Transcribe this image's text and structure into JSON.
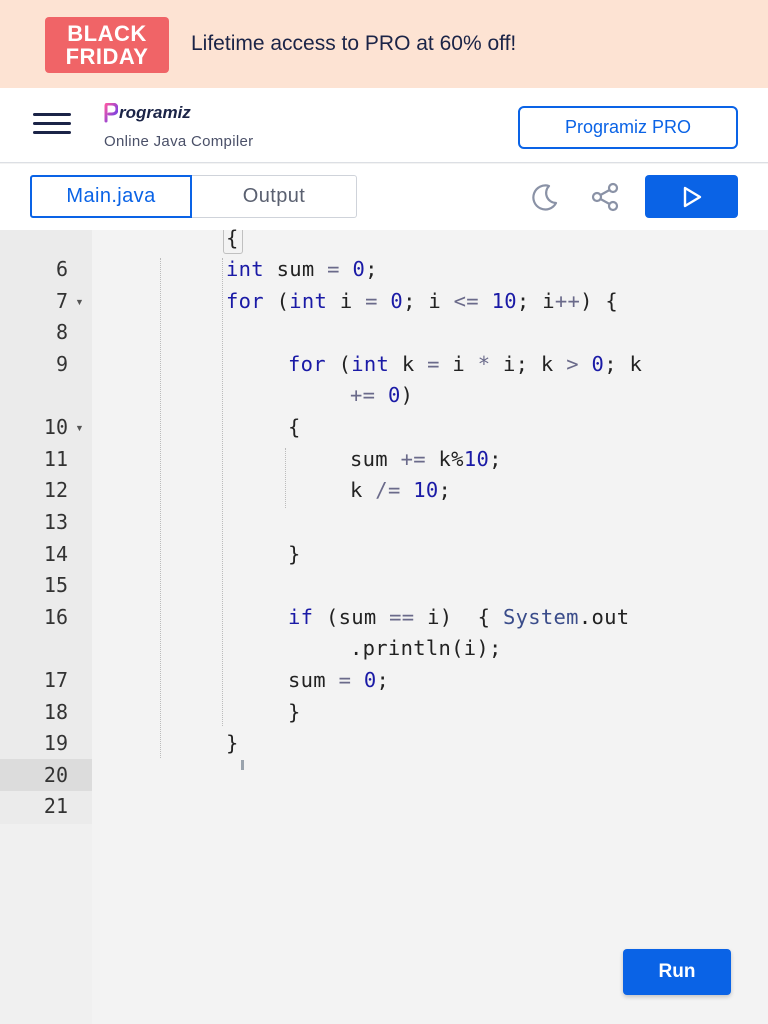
{
  "promo": {
    "badge_line1": "BLACK",
    "badge_line2": "FRIDAY",
    "text": "Lifetime access to PRO at 60% off!"
  },
  "header": {
    "logo_text": "rogramiz",
    "subtitle": "Online Java Compiler",
    "pro_button": "Programiz PRO"
  },
  "toolbar": {
    "tabs": [
      {
        "label": "Main.java",
        "active": true
      },
      {
        "label": "Output",
        "active": false
      }
    ],
    "icons": [
      "moon-icon",
      "share-icon",
      "play-icon"
    ]
  },
  "editor": {
    "line_numbers": [
      "6",
      "7",
      "8",
      "9",
      "10",
      "11",
      "12",
      "13",
      "14",
      "15",
      "16",
      "17",
      "18",
      "19",
      "20",
      "21"
    ],
    "folded_lines": [
      "7",
      "10"
    ],
    "active_line": "20",
    "lines": [
      {
        "num": "",
        "text": "{"
      },
      {
        "num": "6",
        "text": "int sum = 0;"
      },
      {
        "num": "7",
        "text": "for (int i = 0; i <= 10; i++) {"
      },
      {
        "num": "8",
        "text": ""
      },
      {
        "num": "9",
        "text": "for (int k = i * i; k > 0; k"
      },
      {
        "num": "",
        "text": "+= 0)"
      },
      {
        "num": "10",
        "text": "{"
      },
      {
        "num": "11",
        "text": "sum += k%10;"
      },
      {
        "num": "12",
        "text": "k /= 10;"
      },
      {
        "num": "13",
        "text": ""
      },
      {
        "num": "14",
        "text": "}"
      },
      {
        "num": "15",
        "text": ""
      },
      {
        "num": "16",
        "text": "if (sum == i)  { System.out"
      },
      {
        "num": "",
        "text": ".println(i);"
      },
      {
        "num": "17",
        "text": "sum = 0;"
      },
      {
        "num": "18",
        "text": "}"
      },
      {
        "num": "19",
        "text": "}"
      },
      {
        "num": "20",
        "text": ""
      },
      {
        "num": "21",
        "text": ""
      }
    ]
  },
  "run_button": "Run",
  "colors": {
    "accent": "#0a63e6",
    "promo_bg": "#fde3d3",
    "badge_bg": "#f06467",
    "keyword": "#1a1aa6"
  }
}
